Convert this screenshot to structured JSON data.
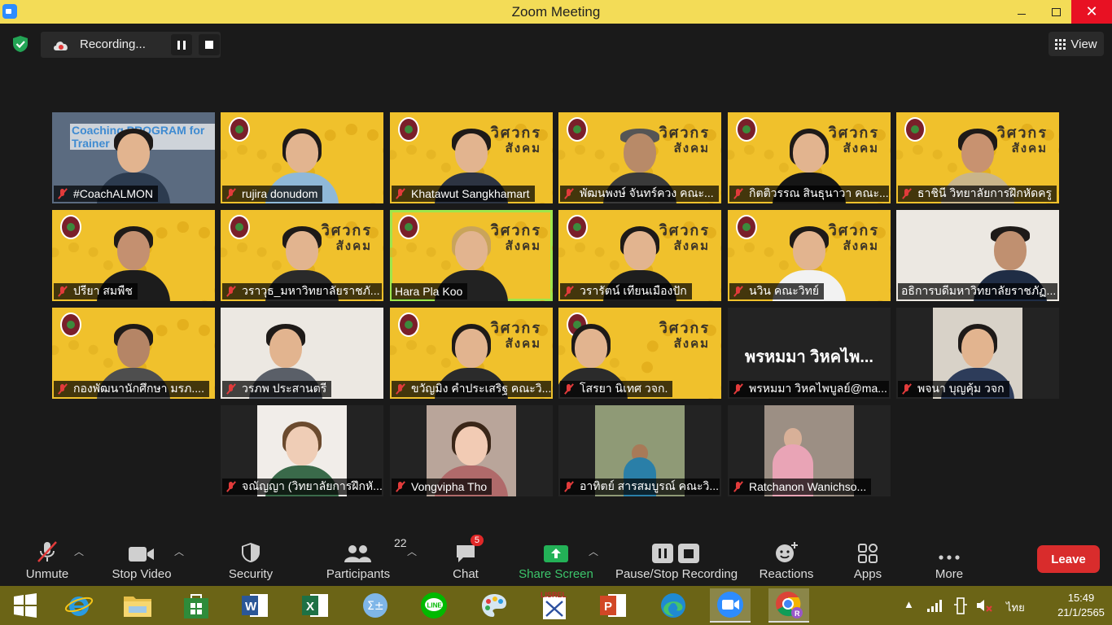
{
  "window": {
    "title": "Zoom Meeting"
  },
  "recording": {
    "label": "Recording..."
  },
  "view": {
    "label": "View"
  },
  "participants": [
    {
      "name": "#CoachALMON",
      "overlay": "Coaching PROGRAM for Trainer"
    },
    {
      "name": "rujira donudom"
    },
    {
      "name": "Khatawut Sangkhamart"
    },
    {
      "name": "พัฒนพงษ์ จันทร์ควง คณะ..."
    },
    {
      "name": "กิตติวรรณ สินธุนาวา คณะ..."
    },
    {
      "name": "ธาชินี วิทยาลัยการฝึกหัดครู"
    },
    {
      "name": "ปรียา สมพืช"
    },
    {
      "name": "วราวุธ_มหาวิทยาลัยราชภั..."
    },
    {
      "name": "Hara Pla Koo"
    },
    {
      "name": "วรารัตน์ เทียนเมืองปัก"
    },
    {
      "name": "นวิน คณะวิทย์"
    },
    {
      "name": "อธิการบดีมหาวิทยาลัยราชภัฏ..."
    },
    {
      "name": "กองพัฒนานักศึกษา มรภ...."
    },
    {
      "name": "วรภพ ประสานตรี"
    },
    {
      "name": "ขวัญมิง คำประเสริฐ คณะวิ..."
    },
    {
      "name": "โสรยา นิเทศ วจก."
    },
    {
      "name": "พรหมมา วิหคไพบูลย์@ma...",
      "overlay": "พรหมมา วิหคไพ..."
    },
    {
      "name": "พจนา บุญคุ้ม วจก"
    },
    {
      "name": "จณัญญา (วิทยาลัยการฝึกหั..."
    },
    {
      "name": "Vongvipha Tho"
    },
    {
      "name": "อาทิตย์ สารสมบูรณ์ คณะวิ..."
    },
    {
      "name": "Ratchanon Wanichso..."
    }
  ],
  "brand": {
    "line1": "วิศวกร",
    "line2": "สังคม"
  },
  "toolbar": {
    "unmute": "Unmute",
    "stop_video": "Stop Video",
    "security": "Security",
    "participants": "Participants",
    "participants_count": "22",
    "chat": "Chat",
    "chat_badge": "5",
    "share_screen": "Share Screen",
    "pause_stop_recording": "Pause/Stop Recording",
    "reactions": "Reactions",
    "apps": "Apps",
    "more": "More",
    "leave": "Leave"
  },
  "taskbar": {
    "language": "ไทย",
    "time": "15:49",
    "date": "21/1/2565"
  },
  "colors": {
    "titlebar": "#f3dc57",
    "leave": "#d92c2c",
    "share": "#3cc56b",
    "active_speaker": "#9fe64b"
  }
}
